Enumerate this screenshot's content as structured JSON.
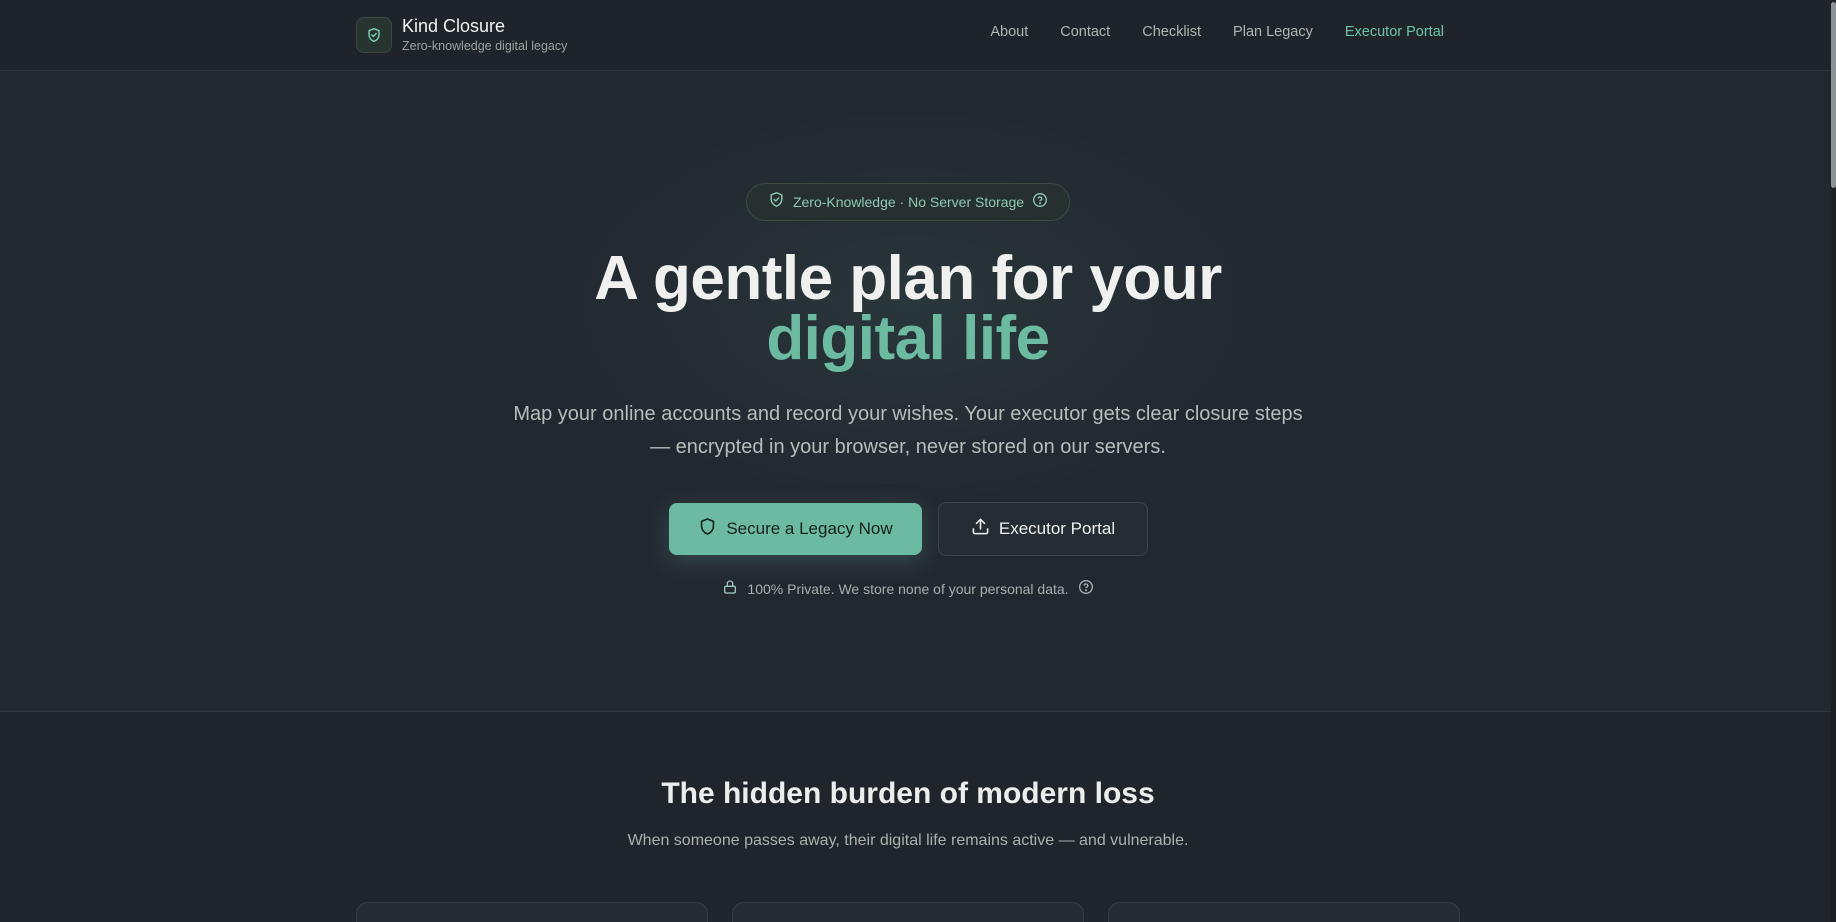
{
  "brand": {
    "name": "Kind Closure",
    "tagline": "Zero-knowledge digital legacy"
  },
  "nav": {
    "items": [
      {
        "label": "About",
        "active": false
      },
      {
        "label": "Contact",
        "active": false
      },
      {
        "label": "Checklist",
        "active": false
      },
      {
        "label": "Plan Legacy",
        "active": false
      },
      {
        "label": "Executor Portal",
        "active": true
      }
    ]
  },
  "hero": {
    "badge": "Zero-Knowledge · No Server Storage",
    "headline_line1": "A gentle plan for your",
    "headline_line2": "digital life",
    "subtext": "Map your online accounts and record your wishes. Your executor gets clear closure steps — encrypted in your browser, never stored on our servers.",
    "primary_cta": "Secure a Legacy Now",
    "secondary_cta": "Executor Portal",
    "privacy_note": "100% Private. We store none of your personal data."
  },
  "burden": {
    "title": "The hidden burden of modern loss",
    "subtitle": "When someone passes away, their digital life remains active — and vulnerable."
  },
  "colors": {
    "background": "#20252b",
    "accent": "#6cbba1",
    "nav_active": "#6cc5a9",
    "primary_button": "#6cbaa2"
  },
  "icons": [
    "shield-check-icon",
    "help-circle-icon",
    "shield-icon",
    "upload-icon",
    "lock-icon"
  ]
}
